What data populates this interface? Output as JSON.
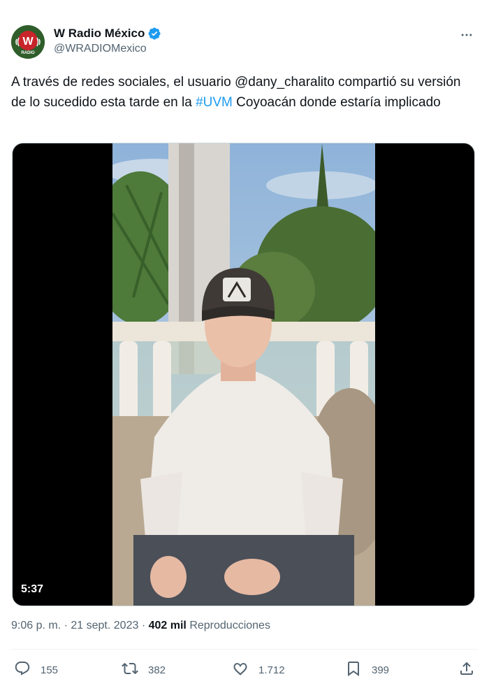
{
  "author": {
    "display_name": "W Radio México",
    "handle": "@WRADIOMexico",
    "avatar_text": "W",
    "avatar_subtext": "RADIO"
  },
  "tweet": {
    "text_before": "A través de redes sociales, el usuario @dany_charalito compartió su versión de lo sucedido esta tarde en la ",
    "hashtag": "#UVM",
    "text_after": " Coyoacán donde estaría implicado"
  },
  "media": {
    "duration": "5:37"
  },
  "meta": {
    "time": "9:06 p. m.",
    "separator": "·",
    "date": "21 sept. 2023",
    "views_count": "402 mil",
    "views_label": "Reproducciones"
  },
  "actions": {
    "replies": "155",
    "retweets": "382",
    "likes": "1.712",
    "bookmarks": "399"
  },
  "colors": {
    "accent": "#1d9bf0",
    "text": "#0f1419",
    "secondary": "#536471"
  }
}
